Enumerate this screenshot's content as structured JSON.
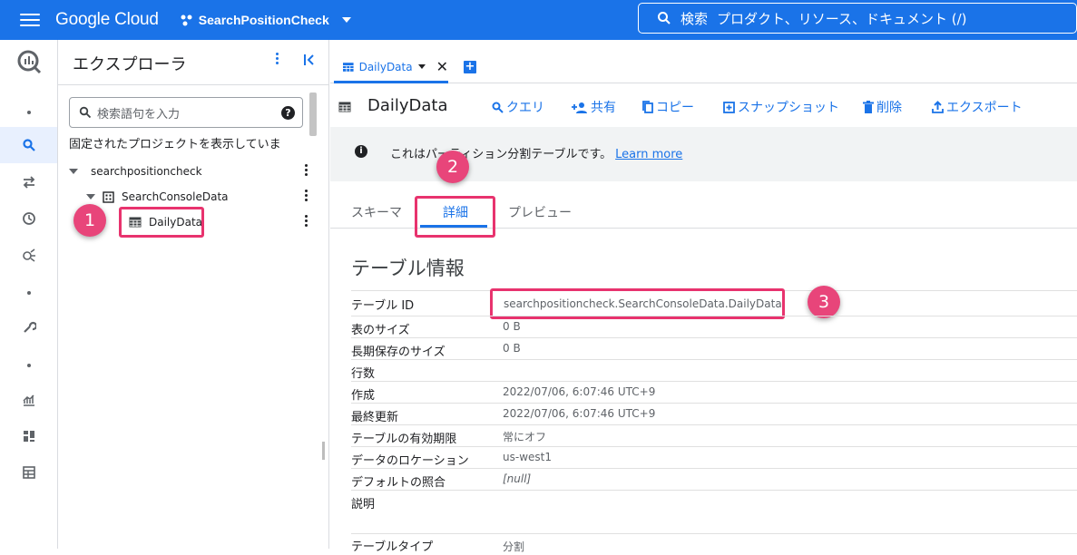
{
  "topbar": {
    "logo": "Google Cloud",
    "project": "SearchPositionCheck",
    "search_label": "検索",
    "search_hint": "プロダクト、リソース、ドキュメント (/)"
  },
  "rail": {
    "icons": [
      "bigquery-logo-icon",
      "dot",
      "search-icon",
      "transfer-icon",
      "history-icon",
      "analytics-hub-icon",
      "dot",
      "wrench-icon",
      "dot",
      "chart-icon",
      "dashboard-icon",
      "table-grid-icon"
    ]
  },
  "explorer": {
    "title": "エクスプローラ",
    "search_placeholder": "検索語句を入力",
    "pinned_text": "固定されたプロジェクトを表示していま",
    "project": "searchpositioncheck",
    "dataset": "SearchConsoleData",
    "table": "DailyData"
  },
  "tabs": [
    {
      "label": "DailyData"
    }
  ],
  "toolbar": {
    "title": "DailyData",
    "query": "クエリ",
    "share": "共有",
    "copy": "コピー",
    "snapshot": "スナップショット",
    "delete": "削除",
    "export": "エクスポート"
  },
  "banner": {
    "message": "これはパーティション分割テーブルです。",
    "learn_more": "Learn more"
  },
  "subtabs": {
    "schema": "スキーマ",
    "details": "詳細",
    "preview": "プレビュー"
  },
  "details": {
    "section_title": "テーブル情報",
    "rows": [
      {
        "key": "テーブル ID",
        "value": "searchpositioncheck.SearchConsoleData.DailyData"
      },
      {
        "key": "表のサイズ",
        "value": "0 B"
      },
      {
        "key": "長期保存のサイズ",
        "value": "0 B"
      },
      {
        "key": "行数",
        "value": ""
      },
      {
        "key": "作成",
        "value": "2022/07/06, 6:07:46 UTC+9"
      },
      {
        "key": "最終更新",
        "value": "2022/07/06, 6:07:46 UTC+9"
      },
      {
        "key": "テーブルの有効期限",
        "value": "常にオフ"
      },
      {
        "key": "データのロケーション",
        "value": "us-west1"
      },
      {
        "key": "デフォルトの照合",
        "value": "[null]"
      },
      {
        "key": "説明",
        "value": ""
      },
      {
        "key": "テーブルタイプ",
        "value": "分割"
      }
    ]
  },
  "annotations": {
    "step1": "1",
    "step2": "2",
    "step3": "3",
    "color": "#e8336e"
  }
}
